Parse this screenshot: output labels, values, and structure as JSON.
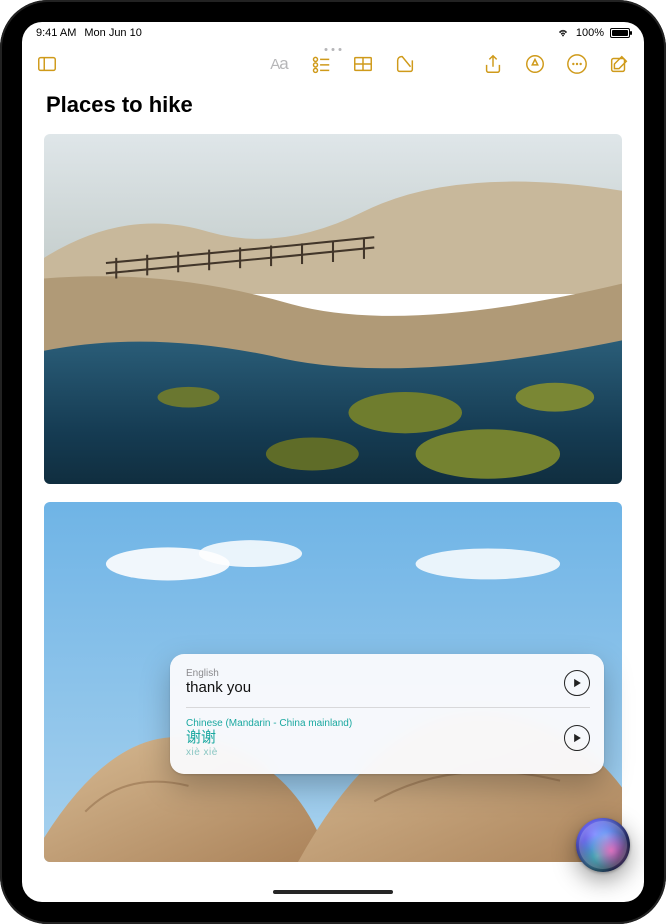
{
  "status": {
    "time": "9:41 AM",
    "date": "Mon Jun 10",
    "battery_pct": "100%"
  },
  "toolbar": {
    "sidebar": "sidebar",
    "format": "Aa",
    "checklist": "checklist",
    "table": "table",
    "attach": "attach",
    "share": "share",
    "markup": "markup",
    "more": "more",
    "compose": "compose"
  },
  "note": {
    "title": "Places to hike"
  },
  "translate": {
    "src_lang": "English",
    "src_text": "thank you",
    "dst_lang": "Chinese (Mandarin - China mainland)",
    "dst_text": "谢谢",
    "dst_roman": "xiè xiè"
  },
  "colors": {
    "accent": "#cf9a1a",
    "teal": "#1aa8a0"
  }
}
